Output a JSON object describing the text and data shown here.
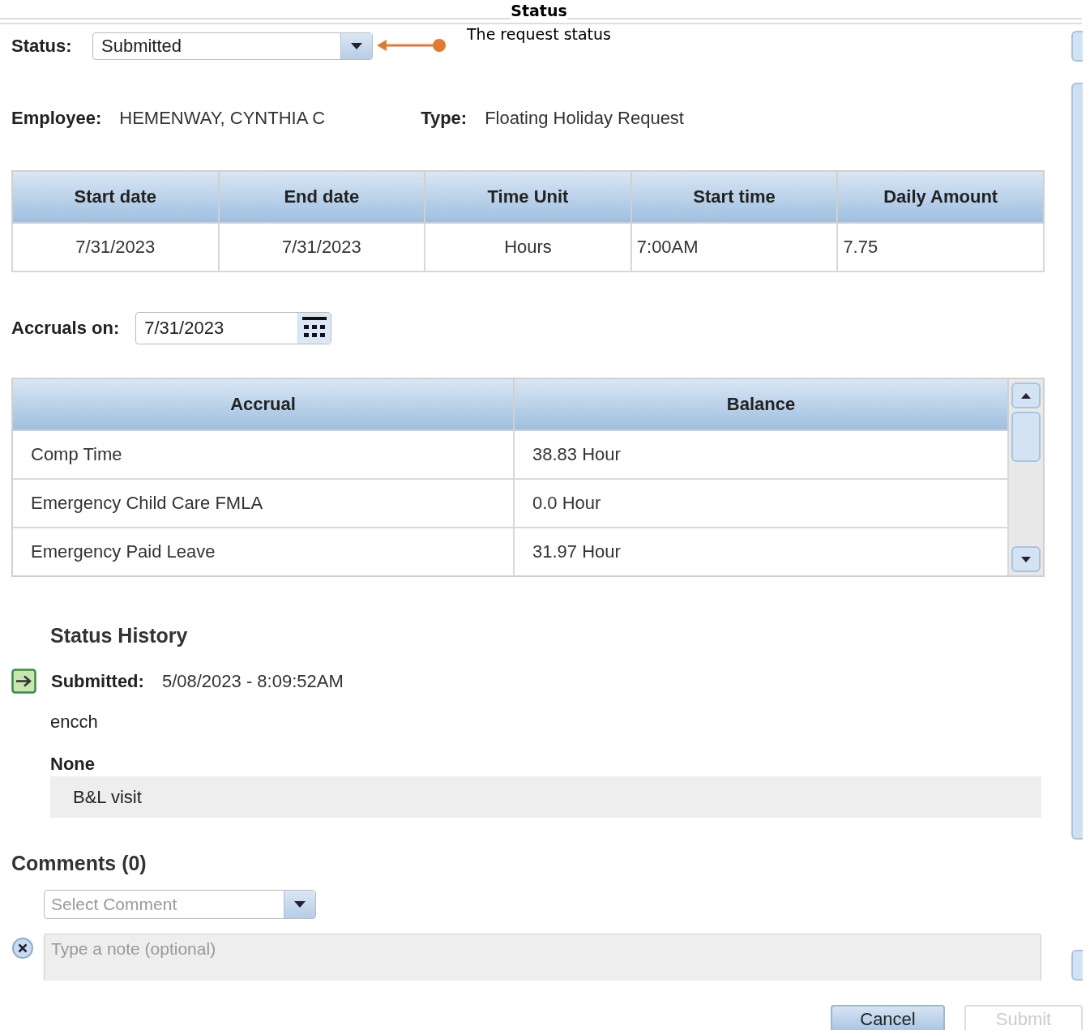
{
  "annotation": {
    "title": "Status",
    "text": "The request status"
  },
  "status": {
    "label": "Status:",
    "value": "Submitted"
  },
  "info": [
    {
      "label": "Employee:",
      "value": "HEMENWAY, CYNTHIA C"
    },
    {
      "label": "Type:",
      "value": "Floating Holiday Request"
    }
  ],
  "request_table": {
    "columns": [
      "Start date",
      "End date",
      "Time Unit",
      "Start time",
      "Daily Amount"
    ],
    "rows": [
      [
        "7/31/2023",
        "7/31/2023",
        "Hours",
        "7:00AM",
        "7.75"
      ]
    ]
  },
  "accruals_on": {
    "label": "Accruals on:",
    "value": "7/31/2023"
  },
  "accrual_table": {
    "columns": [
      "Accrual",
      "Balance"
    ],
    "rows": [
      [
        "Comp Time",
        "38.83 Hour"
      ],
      [
        "Emergency Child Care FMLA",
        "0.0 Hour"
      ],
      [
        "Emergency Paid Leave",
        "31.97 Hour"
      ]
    ]
  },
  "status_history": {
    "title": "Status History",
    "entries": [
      {
        "status": "Submitted:",
        "timestamp": "5/08/2023 - 8:09:52AM",
        "user": "encch",
        "reason": "None",
        "note": "B&L visit"
      }
    ]
  },
  "comments": {
    "title": "Comments (0)",
    "select": {
      "placeholder": "Select Comment"
    },
    "note": {
      "placeholder": "Type a note (optional)"
    }
  },
  "buttons": [
    {
      "label": "Cancel",
      "disabled": false
    },
    {
      "label": "Submit",
      "disabled": true
    }
  ]
}
